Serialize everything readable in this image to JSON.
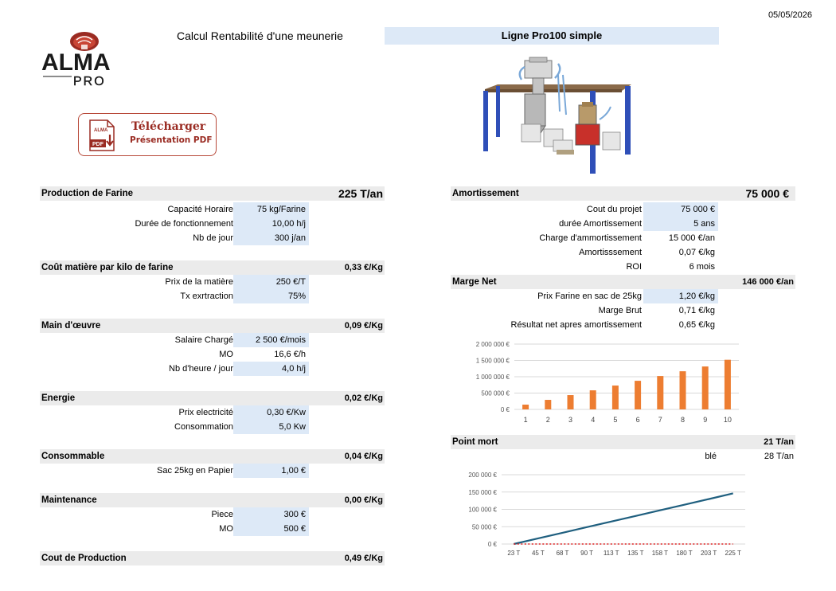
{
  "header": {
    "date": "05/05/2026",
    "title": "Calcul Rentabilité d'une meunerie",
    "subtitle": "Ligne Pro100 simple"
  },
  "logo": {
    "brand": "ALMA",
    "sub": "PRO"
  },
  "download": {
    "line1": "Télécharger",
    "line2": "Présentation PDF",
    "icon_label": "PDF",
    "icon_brand": "ALMA"
  },
  "left": {
    "production": {
      "title": "Production de Farine",
      "value": "225 T/an",
      "rows": [
        {
          "label": "Capacité Horaire",
          "value": "75 kg/Farine"
        },
        {
          "label": "Durée de fonctionnement",
          "value": "10,00 h/j"
        },
        {
          "label": "Nb de jour",
          "value": "300 j/an"
        }
      ]
    },
    "matiere": {
      "title": "Coût matière par kilo de farine",
      "value": "0,33 €/Kg",
      "rows": [
        {
          "label": "Prix  de la matière",
          "value": "250 €/T"
        },
        {
          "label": "Tx exrtraction",
          "value": "75%"
        }
      ]
    },
    "main_oeuvre": {
      "title": "Main d'œuvre",
      "value": "0,09 €/Kg",
      "rows": [
        {
          "label": "Salaire Chargé",
          "value": "2 500 €/mois"
        },
        {
          "label": "MO",
          "value": "16,6 €/h"
        },
        {
          "label": "Nb d'heure / jour",
          "value": "4,0 h/j"
        }
      ]
    },
    "energie": {
      "title": "Energie",
      "value": "0,02 €/Kg",
      "rows": [
        {
          "label": "Prix electricité",
          "value": "0,30 €/Kw"
        },
        {
          "label": "Consommation",
          "value": "5,0 Kw"
        }
      ]
    },
    "consommable": {
      "title": "Consommable",
      "value": "0,04 €/Kg",
      "rows": [
        {
          "label": "Sac 25kg en Papier",
          "value": "1,00 €"
        }
      ]
    },
    "maintenance": {
      "title": "Maintenance",
      "value": "0,00 €/Kg",
      "rows": [
        {
          "label": "Piece",
          "value": "300 €"
        },
        {
          "label": "MO",
          "value": "500 €"
        }
      ]
    },
    "cout": {
      "title": "Cout  de Production",
      "value": "0,49 €/Kg"
    }
  },
  "right": {
    "amortissement": {
      "title": "Amortissement",
      "value": "75 000 €",
      "rows": [
        {
          "label": "Cout du projet",
          "value": "75 000 €"
        },
        {
          "label": "durée Amortissement",
          "value": "5 ans"
        },
        {
          "label": "Charge d'ammortissement",
          "value": "15 000 €/an"
        },
        {
          "label": "Amortisssement",
          "value": "0,07 €/kg"
        },
        {
          "label": "ROI",
          "value": "6 mois"
        }
      ]
    },
    "marge": {
      "title": "Marge Net",
      "value": "146 000 €/an",
      "rows": [
        {
          "label": "Prix  Farine en sac de 25kg",
          "value": "1,20 €/kg"
        },
        {
          "label": "Marge Brut",
          "value": "0,71 €/kg"
        },
        {
          "label": "Résultat net apres amortissement",
          "value": "0,65 €/kg"
        }
      ]
    },
    "point_mort": {
      "title": "Point mort",
      "value": "21 T/an",
      "sub_label": "blé",
      "sub_value": "28 T/an"
    }
  },
  "colors": {
    "input_bg": "#dde9f7",
    "header_bg": "#ebebeb",
    "bar": "#ed7d31",
    "line": "#1f5f7f",
    "dotted": "#e02020",
    "logo_red": "#9a2b22"
  },
  "chart_data": [
    {
      "type": "bar",
      "categories": [
        "1",
        "2",
        "3",
        "4",
        "5",
        "6",
        "7",
        "8",
        "9",
        "10"
      ],
      "values": [
        146000,
        292000,
        438000,
        584000,
        730000,
        876000,
        1022000,
        1168000,
        1314000,
        1520000
      ],
      "yticks": [
        "2 000 000 €",
        "1 500 000 €",
        "1 000 000 €",
        "500 000 €",
        "0 €"
      ],
      "ylim": [
        0,
        2000000
      ],
      "grid": true
    },
    {
      "type": "line",
      "categories": [
        "23 T",
        "45 T",
        "68 T",
        "90 T",
        "113 T",
        "135 T",
        "158 T",
        "180 T",
        "203 T",
        "225 T"
      ],
      "series": [
        {
          "values": [
            0,
            16200,
            32400,
            48600,
            64800,
            81000,
            97200,
            113400,
            129600,
            146000
          ],
          "style": "solid"
        },
        {
          "values": [
            0,
            0,
            0,
            0,
            0,
            0,
            0,
            0,
            0,
            0
          ],
          "style": "dotted"
        }
      ],
      "yticks": [
        "200 000 €",
        "150 000 €",
        "100 000 €",
        "50 000 €",
        "0 €"
      ],
      "ylim": [
        0,
        200000
      ],
      "grid": true
    }
  ]
}
